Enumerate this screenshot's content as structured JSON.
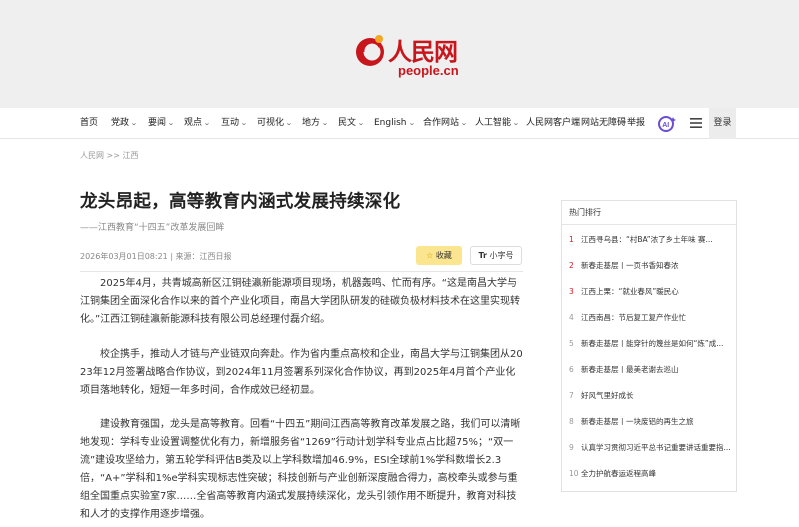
{
  "site": {
    "logo_cn": "人民网",
    "logo_en": "people.cn",
    "brand_color": "#c8161d"
  },
  "nav": {
    "items": [
      {
        "label": "首页",
        "caret": false
      },
      {
        "label": "党政",
        "caret": true
      },
      {
        "label": "要闻",
        "caret": true
      },
      {
        "label": "观点",
        "caret": true
      },
      {
        "label": "互动",
        "caret": true
      },
      {
        "label": "可视化",
        "caret": true
      },
      {
        "label": "地方",
        "caret": true
      },
      {
        "label": "民文",
        "caret": true
      },
      {
        "label": "English",
        "caret": true
      },
      {
        "label": "合作网站",
        "caret": true
      },
      {
        "label": "人工智能",
        "caret": true
      },
      {
        "label": "人民网客户端",
        "caret": false
      },
      {
        "label": "网站无障碍",
        "caret": false
      },
      {
        "label": "举报",
        "caret": false
      }
    ],
    "ai_icon": "ai-search-icon",
    "menu_icon": "hamburger-menu-icon",
    "login_label": "登录"
  },
  "breadcrumb": {
    "home": "人民网",
    "sep": ">>",
    "section": "江西"
  },
  "article": {
    "title": "龙头昂起，高等教育内涵式发展持续深化",
    "subtitle": "——江西教育“十四五”改革发展回眸",
    "meta": "2026年03月01日08:21 | 来源：江西日报",
    "fav_label": "收藏",
    "font_label": "小字号",
    "font_icon_text": "Tr",
    "paragraphs": [
      "2025年4月，共青城高新区江铜硅瀛新能源项目现场，机器轰鸣、忙而有序。“这是南昌大学与江铜集团全面深化合作以来的首个产业化项目，南昌大学团队研发的硅碳负极材料技术在这里实现转化。”江西江铜硅瀛新能源科技有限公司总经理付磊介绍。",
      "校企携手，推动人才链与产业链双向奔赴。作为省内重点高校和企业，南昌大学与江铜集团从2023年12月签署战略合作协议，到2024年11月签署系列深化合作协议，再到2025年4月首个产业化项目落地转化，短短一年多时间，合作成效已经初显。",
      "建设教育强国，龙头是高等教育。回看“十四五”期间江西高等教育改革发展之路，我们可以清晰地发现：学科专业设置调整优化有力，新增服务省“1269”行动计划学科专业点占比超75%；“双一流”建设攻坚给力，第五轮学科评估B类及以上学科数增加46.9%，ESI全球前1%学科数增长2.3倍，“A+”学科和1%e学科实现标志性突破；科技创新与产业创新深度融合得力，高校牵头或参与重组全国重点实验室7家……全省高等教育内涵式发展持续深化，龙头引领作用不断提升，教育对科技和人才的支撑作用逐步增强。"
    ]
  },
  "hot": {
    "heading": "热门排行",
    "items": [
      {
        "num": "1",
        "text": "江西寻乌县：“村BA”浓了乡土年味 赛..."
      },
      {
        "num": "2",
        "text": "新春走基层丨一页书香知春浓"
      },
      {
        "num": "3",
        "text": "江西上栗：“就业春风”暖民心"
      },
      {
        "num": "4",
        "text": "江西南昌：节后复工复产作业忙"
      },
      {
        "num": "5",
        "text": "新春走基层丨能穿针的篾丝是如何“炼”成..."
      },
      {
        "num": "6",
        "text": "新春走基层丨最美老谢去巡山"
      },
      {
        "num": "7",
        "text": "好风气里好成长"
      },
      {
        "num": "8",
        "text": "新春走基层丨一块废铝的再生之旅"
      },
      {
        "num": "9",
        "text": "认真学习贯彻习近平总书记重要讲话重要指..."
      },
      {
        "num": "10",
        "text": "全力护航春运返程高峰"
      }
    ]
  }
}
